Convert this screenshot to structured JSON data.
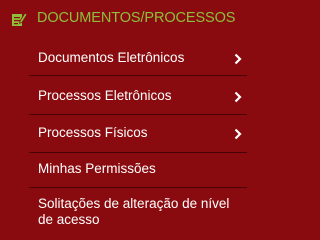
{
  "header": {
    "title": "DOCUMENTOS/PROCESSOS",
    "icon": "edit-document-icon",
    "title_color": "#8fbf3a"
  },
  "colors": {
    "background": "#8a0b0f",
    "divider": "#4a0305",
    "text": "#ffffff"
  },
  "items": [
    {
      "label": "Documentos Eletrônicos",
      "has_submenu": true,
      "icon": "chevron-right-icon"
    },
    {
      "label": "Processos Eletrônicos",
      "has_submenu": true,
      "icon": "chevron-right-icon"
    },
    {
      "label": "Processos Físicos",
      "has_submenu": true,
      "icon": "chevron-right-icon"
    },
    {
      "label": "Minhas Permissões",
      "has_submenu": false
    },
    {
      "label": "Solitações de alteração de nível de acesso",
      "has_submenu": false
    }
  ]
}
